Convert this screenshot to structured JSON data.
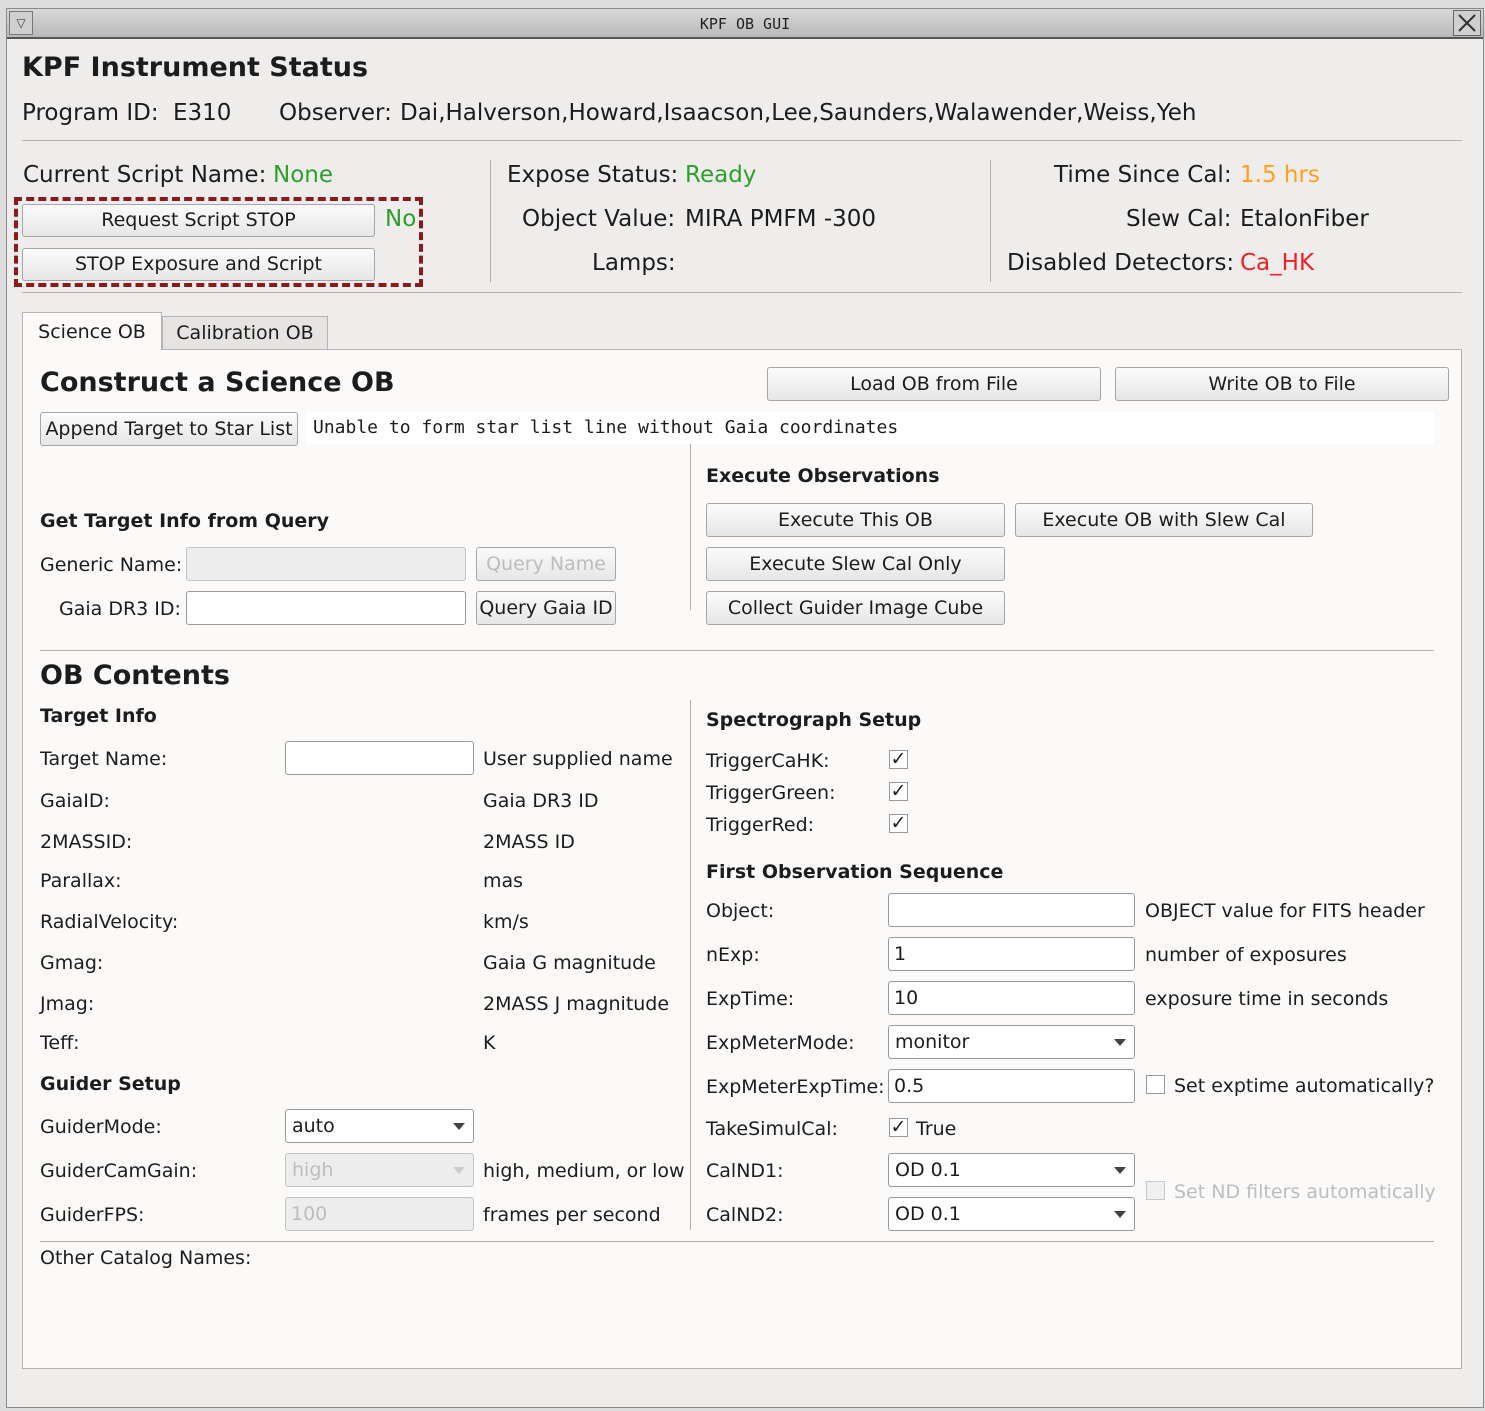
{
  "window": {
    "title": "KPF OB GUI"
  },
  "status": {
    "heading": "KPF Instrument Status",
    "program_id_label": "Program ID:",
    "program_id": "E310",
    "observer_label": "Observer:",
    "observer": "Dai,Halverson,Howard,Isaacson,Lee,Saunders,Walawender,Weiss,Yeh",
    "script_name_label": "Current Script Name:",
    "script_name": "None",
    "request_stop_label": "Request Script STOP",
    "stop_requested": "No",
    "stop_exposure_label": "STOP Exposure and Script",
    "expose_status_label": "Expose Status:",
    "expose_status": "Ready",
    "object_value_label": "Object Value:",
    "object_value": "MIRA PMFM -300",
    "lamps_label": "Lamps:",
    "lamps": "",
    "time_since_cal_label": "Time Since Cal:",
    "time_since_cal": "1.5 hrs",
    "slew_cal_label": "Slew Cal:",
    "slew_cal": "EtalonFiber",
    "disabled_detectors_label": "Disabled Detectors:",
    "disabled_detectors": "Ca_HK",
    "colors": {
      "good": "#2ca02c",
      "warn": "#ff9f1a",
      "bad": "#ee2222",
      "highlight": "#8b1a1a"
    }
  },
  "tabs": [
    {
      "label": "Science OB",
      "active": true
    },
    {
      "label": "Calibration OB",
      "active": false
    }
  ],
  "construct": {
    "heading": "Construct a Science OB",
    "load_label": "Load OB from File",
    "write_label": "Write OB to File",
    "append_label": "Append Target to Star List",
    "starlist_message": "Unable to form star list line without Gaia coordinates"
  },
  "query": {
    "heading": "Get Target Info from Query",
    "generic_name_label": "Generic Name:",
    "generic_name_value": "",
    "query_name_label": "Query Name",
    "gaia_id_label": "Gaia DR3 ID:",
    "gaia_id_value": "",
    "query_gaia_label": "Query Gaia ID"
  },
  "execute": {
    "heading": "Execute Observations",
    "execute_ob_label": "Execute This OB",
    "execute_slew_label": "Execute OB with Slew Cal",
    "slew_only_label": "Execute Slew Cal Only",
    "guider_cube_label": "Collect Guider Image Cube"
  },
  "contents": {
    "heading": "OB Contents",
    "target_heading": "Target Info",
    "target_name_label": "Target Name:",
    "target_name_value": "",
    "target_name_hint": "User supplied name",
    "fields": [
      {
        "label": "GaiaID:",
        "hint": "Gaia DR3 ID"
      },
      {
        "label": "2MASSID:",
        "hint": "2MASS ID"
      },
      {
        "label": "Parallax:",
        "hint": "mas"
      },
      {
        "label": "RadialVelocity:",
        "hint": "km/s"
      },
      {
        "label": "Gmag:",
        "hint": "Gaia G magnitude"
      },
      {
        "label": "Jmag:",
        "hint": "2MASS J magnitude"
      },
      {
        "label": "Teff:",
        "hint": "K"
      }
    ],
    "guider_heading": "Guider Setup",
    "guider_mode_label": "GuiderMode:",
    "guider_mode": "auto",
    "guider_gain_label": "GuiderCamGain:",
    "guider_gain": "high",
    "guider_gain_hint": "high, medium, or low",
    "guider_fps_label": "GuiderFPS:",
    "guider_fps": "100",
    "guider_fps_hint": "frames per second",
    "other_names_label": "Other Catalog Names:"
  },
  "spectrograph": {
    "heading": "Spectrograph Setup",
    "triggers": [
      {
        "label": "TriggerCaHK:",
        "checked": true
      },
      {
        "label": "TriggerGreen:",
        "checked": true
      },
      {
        "label": "TriggerRed:",
        "checked": true
      }
    ],
    "sequence_heading": "First Observation Sequence",
    "object_label": "Object:",
    "object_value": "",
    "object_hint": "OBJECT value for FITS header",
    "nexp_label": "nExp:",
    "nexp_value": "1",
    "nexp_hint": "number of exposures",
    "exptime_label": "ExpTime:",
    "exptime_value": "10",
    "exptime_hint": "exposure time in seconds",
    "expmeter_mode_label": "ExpMeterMode:",
    "expmeter_mode": "monitor",
    "expmeter_exptime_label": "ExpMeterExpTime:",
    "expmeter_exptime": "0.5",
    "auto_exptime_label": "Set exptime automatically?",
    "simulcal_label": "TakeSimulCal:",
    "simulcal_value": "True",
    "calnd1_label": "CalND1:",
    "calnd1": "OD 0.1",
    "calnd2_label": "CalND2:",
    "calnd2": "OD 0.1",
    "auto_nd_label": "Set ND filters automatically"
  }
}
